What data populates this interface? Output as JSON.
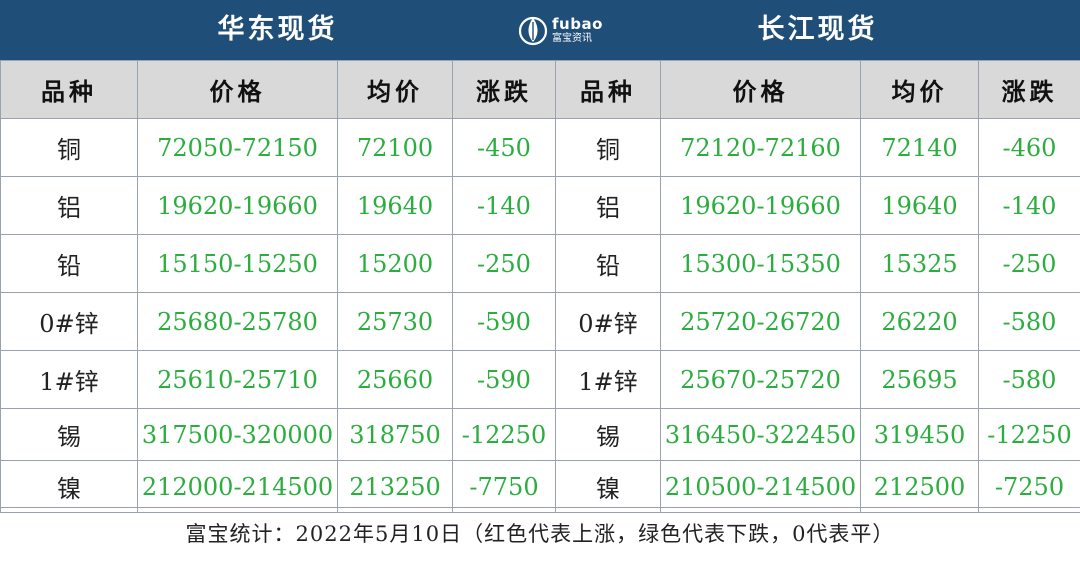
{
  "header": {
    "left_title": "华东现货",
    "right_title": "长江现货",
    "logo_en": "fubao",
    "logo_cn": "富宝资讯",
    "bg_color": "#1f4e79"
  },
  "columns": [
    "品种",
    "价格",
    "均价",
    "涨跌",
    "品种",
    "价格",
    "均价",
    "涨跌"
  ],
  "rows": [
    [
      "铜",
      "72050-72150",
      "72100",
      "-450",
      "铜",
      "72120-72160",
      "72140",
      "-460"
    ],
    [
      "铝",
      "19620-19660",
      "19640",
      "-140",
      "铝",
      "19620-19660",
      "19640",
      "-140"
    ],
    [
      "铅",
      "15150-15250",
      "15200",
      "-250",
      "铅",
      "15300-15350",
      "15325",
      "-250"
    ],
    [
      "0#锌",
      "25680-25780",
      "25730",
      "-590",
      "0#锌",
      "25720-26720",
      "26220",
      "-580"
    ],
    [
      "1#锌",
      "25610-25710",
      "25660",
      "-590",
      "1#锌",
      "25670-25720",
      "25695",
      "-580"
    ],
    [
      "锡",
      "317500-320000",
      "318750",
      "-12250",
      "锡",
      "316450-322450",
      "319450",
      "-12250"
    ],
    [
      "镍",
      "212000-214500",
      "213250",
      "-7750",
      "镍",
      "210500-214500",
      "212500",
      "-7250"
    ]
  ],
  "footer": "富宝统计：2022年5月10日（红色代表上涨，绿色代表下跌，0代表平）",
  "colors": {
    "down": "#2bae3f",
    "header_row": "#d9d9d9",
    "border": "#9aa3ad"
  }
}
